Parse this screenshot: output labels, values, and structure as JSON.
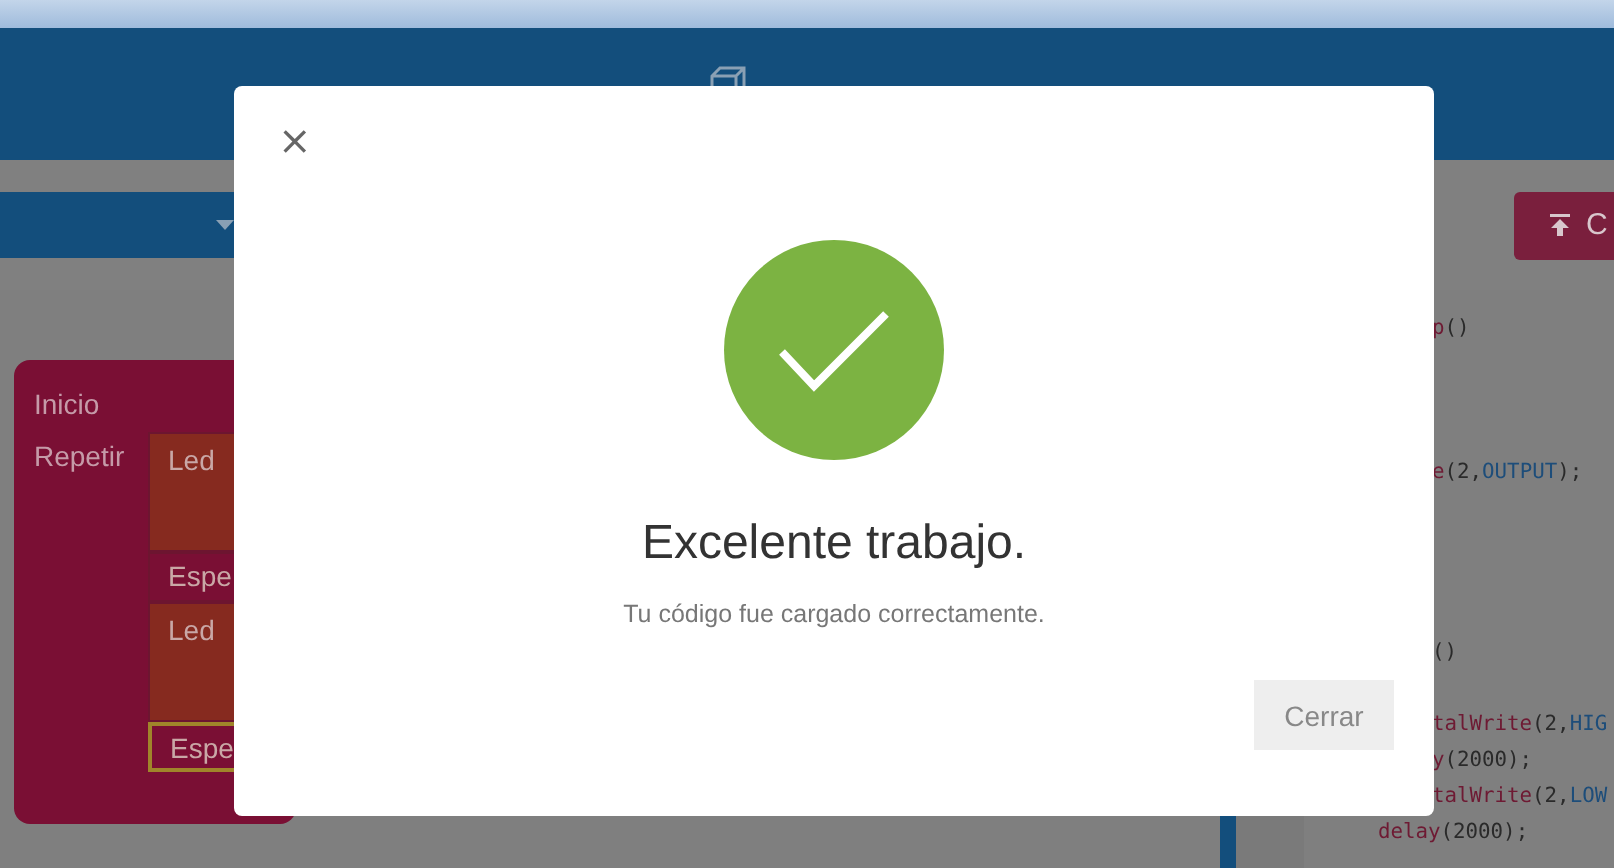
{
  "toolbar": {
    "upload_button": "C"
  },
  "workspace": {
    "blocks": [
      {
        "kind": "start",
        "label": "Inicio"
      },
      {
        "kind": "loop",
        "label": "Repetir",
        "children": [
          {
            "kind": "led",
            "label": "Led",
            "selected": false
          },
          {
            "kind": "wait",
            "label": "Espe",
            "selected": false
          },
          {
            "kind": "led",
            "label": "Led",
            "selected": false
          },
          {
            "kind": "wait",
            "label": "Espe",
            "selected": true
          }
        ]
      }
    ]
  },
  "code": [
    {
      "kind": "cut",
      "tokens": [
        {
          "text": "p",
          "kind": "fn"
        },
        {
          "text": "()",
          "kind": "plain"
        }
      ]
    },
    {
      "kind": "cut",
      "tokens": [
        {
          "text": "e",
          "kind": "fn"
        },
        {
          "text": "(2,",
          "kind": "plain"
        },
        {
          "text": "OUTPUT",
          "kind": "const"
        },
        {
          "text": ");",
          "kind": "plain"
        }
      ]
    },
    {
      "kind": "cut",
      "tokens": [
        {
          "text": "()",
          "kind": "plain"
        }
      ]
    },
    {
      "kind": "cut",
      "tokens": [
        {
          "text": "talWrite",
          "kind": "fn"
        },
        {
          "text": "(2,",
          "kind": "plain"
        },
        {
          "text": "HIG",
          "kind": "const"
        }
      ]
    },
    {
      "kind": "cut",
      "tokens": [
        {
          "text": "y",
          "kind": "fn"
        },
        {
          "text": "(2000);",
          "kind": "plain"
        }
      ]
    },
    {
      "kind": "cut",
      "tokens": [
        {
          "text": "talWrite",
          "kind": "fn"
        },
        {
          "text": "(2,",
          "kind": "plain"
        },
        {
          "text": "LOW",
          "kind": "const"
        }
      ]
    },
    {
      "kind": "full",
      "tokens": [
        {
          "text": "delay",
          "kind": "fn"
        },
        {
          "text": "(2000);",
          "kind": "plain"
        }
      ]
    }
  ],
  "dialog": {
    "close": "×",
    "title": "Excelente trabajo.",
    "message": "Tu código fue cargado correctamente.",
    "button": "Cerrar"
  }
}
